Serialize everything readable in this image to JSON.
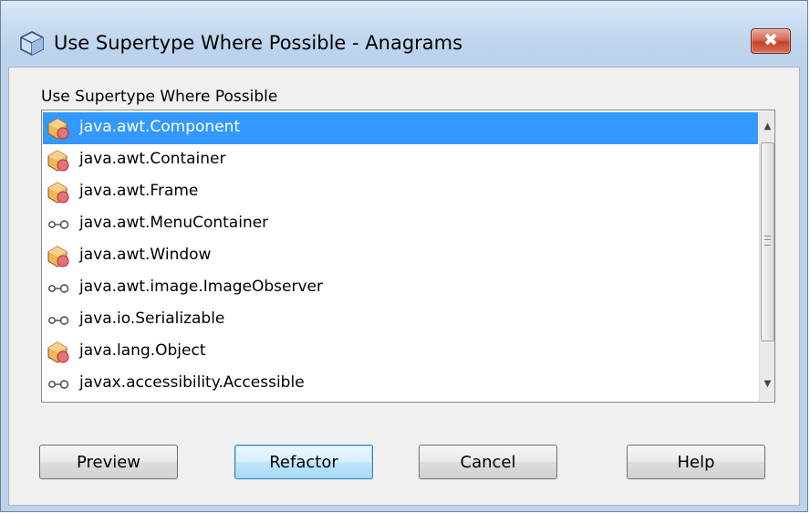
{
  "window": {
    "title": "Use Supertype Where Possible - Anagrams",
    "close_label": "✖"
  },
  "list": {
    "label": "Use Supertype Where Possible",
    "items": [
      {
        "label": "java.awt.Component",
        "icon": "class-icon",
        "selected": true
      },
      {
        "label": "java.awt.Container",
        "icon": "class-icon",
        "selected": false
      },
      {
        "label": "java.awt.Frame",
        "icon": "class-icon",
        "selected": false
      },
      {
        "label": "java.awt.MenuContainer",
        "icon": "interface-icon",
        "selected": false
      },
      {
        "label": "java.awt.Window",
        "icon": "class-icon",
        "selected": false
      },
      {
        "label": "java.awt.image.ImageObserver",
        "icon": "interface-icon",
        "selected": false
      },
      {
        "label": "java.io.Serializable",
        "icon": "interface-icon",
        "selected": false
      },
      {
        "label": "java.lang.Object",
        "icon": "class-icon",
        "selected": false
      },
      {
        "label": "javax.accessibility.Accessible",
        "icon": "interface-icon",
        "selected": false
      }
    ]
  },
  "buttons": {
    "preview": "Preview",
    "refactor": "Refactor",
    "cancel": "Cancel",
    "help": "Help"
  },
  "colors": {
    "selection": "#3399ff",
    "class_icon_body": "#f3b45a",
    "class_icon_badge": "#e57373",
    "close_button": "#c94a32"
  }
}
